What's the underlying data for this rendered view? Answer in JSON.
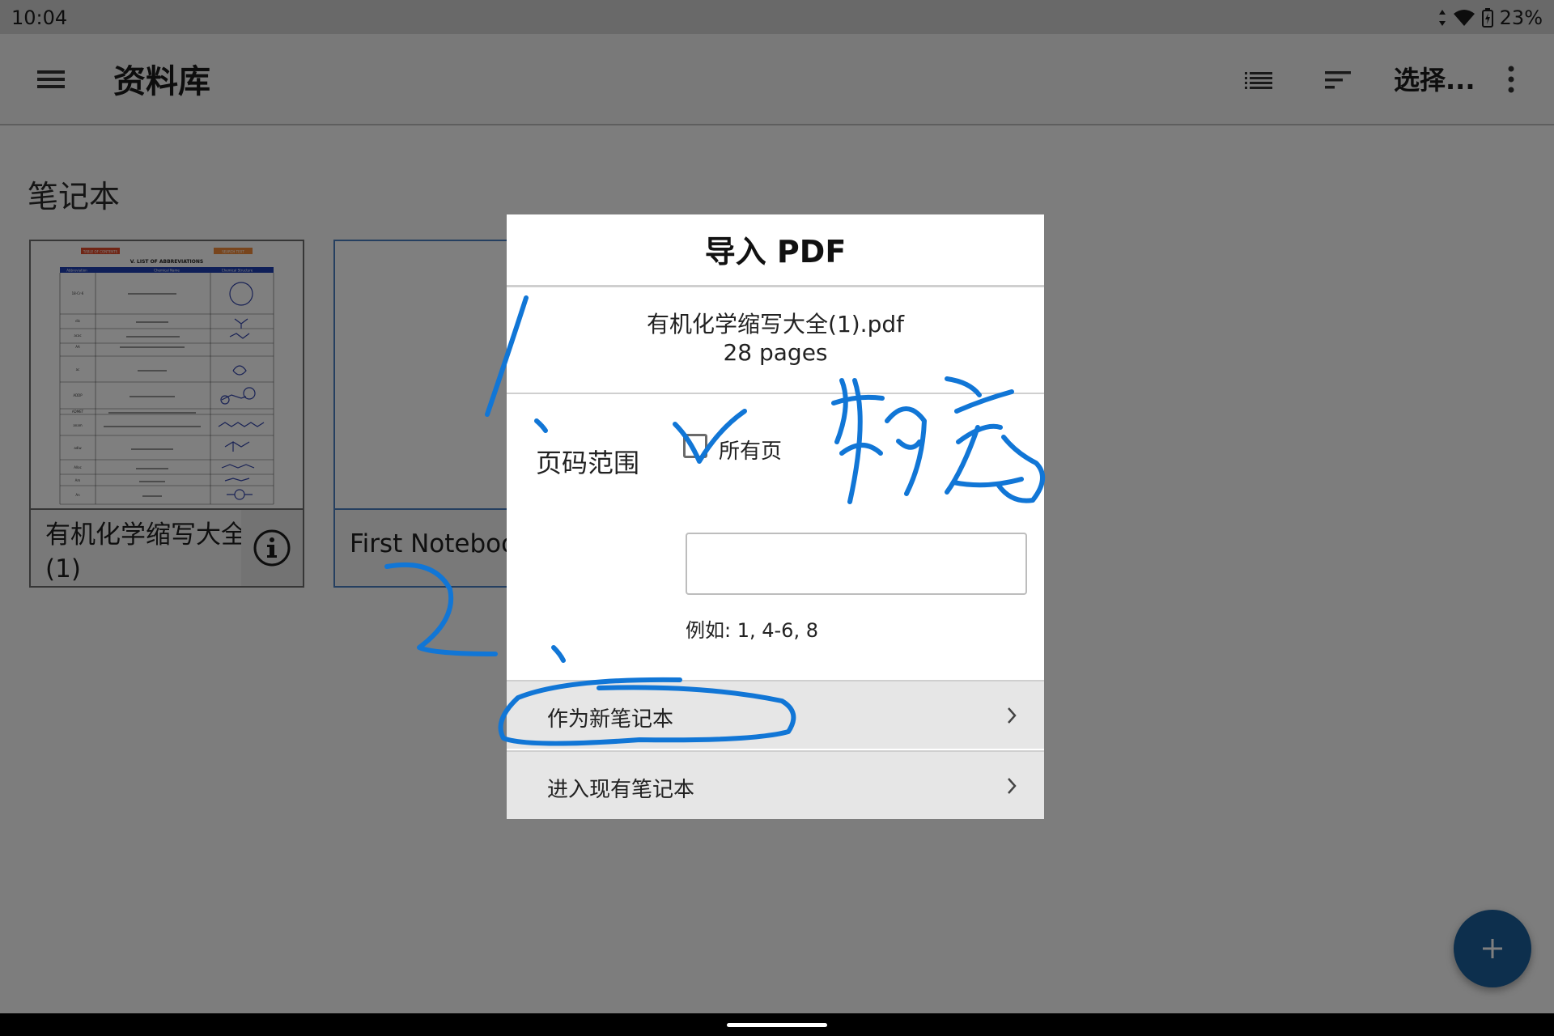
{
  "status_bar": {
    "time": "10:04",
    "battery": "23%"
  },
  "app_bar": {
    "title": "资料库",
    "select_label": "选择..."
  },
  "library": {
    "section_title": "笔记本",
    "notebooks": [
      {
        "name": "有机化学缩写大全(1)"
      },
      {
        "name": "First Notebook"
      }
    ],
    "thumbnail": {
      "tag_left": "TABLE OF CONTENTS",
      "tag_right": "SEARCH TEXT",
      "heading": "V. LIST OF ABBREVIATIONS",
      "columns": [
        "Abbreviation",
        "Chemical Name",
        "Chemical Structure"
      ],
      "rows": [
        "18-Cr-6",
        "dis",
        "acac",
        "AA",
        "ac",
        "ADDP",
        "ADMET",
        "anam",
        "adiw",
        "Alloc",
        "Am",
        "An"
      ]
    }
  },
  "dialog": {
    "title": "导入 PDF",
    "file_name": "有机化学缩写大全(1).pdf",
    "file_pages": "28 pages",
    "range_label": "页码范围",
    "all_pages_label": "所有页",
    "all_pages_checked": false,
    "range_input_value": "",
    "range_example": "例如: 1, 4-6, 8",
    "options": [
      {
        "label": "作为新笔记本"
      },
      {
        "label": "进入现有笔记本"
      }
    ]
  },
  "colors": {
    "ink": "#1176d6",
    "fab": "#1b5f9a",
    "selected_card_border": "#4a7fc0"
  },
  "icons": {
    "menu": "hamburger-icon",
    "list": "list-view-icon",
    "sort": "sort-icon",
    "more": "more-vert-icon",
    "info": "info-icon",
    "fab": "plus-icon",
    "chevron": "chevron-right-icon"
  }
}
